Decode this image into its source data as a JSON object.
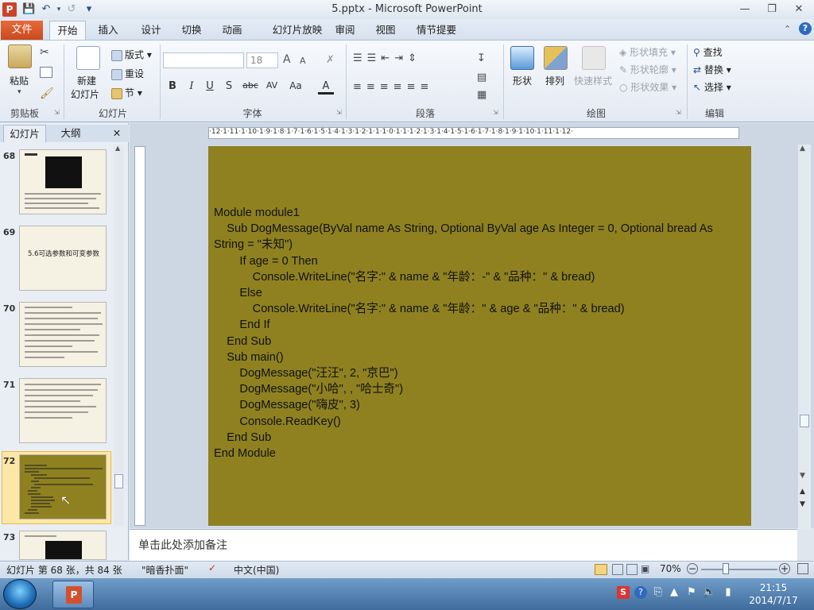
{
  "app": {
    "window_title": "5.pptx - Microsoft PowerPoint",
    "icon_letter": "P",
    "qat_customize": "▾"
  },
  "window_buttons": {
    "minimize": "—",
    "restore": "❐",
    "close": "✕"
  },
  "tabs": [
    "文件",
    "开始",
    "插入",
    "设计",
    "切换",
    "动画",
    "幻灯片放映",
    "审阅",
    "视图",
    "情节提要"
  ],
  "ribbon": {
    "clipboard": {
      "paste": "粘贴",
      "label": "剪贴板"
    },
    "slides": {
      "new_slide_line1": "新建",
      "new_slide_line2": "幻灯片",
      "layout": "版式",
      "reset": "重设",
      "section": "节",
      "label": "幻灯片"
    },
    "font": {
      "font_name": "",
      "font_size": "18",
      "grow": "A",
      "shrink": "A",
      "bold": "B",
      "italic": "I",
      "underline": "U",
      "shadow": "S",
      "strike": "abc",
      "spacing": "AV",
      "case": "Aa",
      "color": "A",
      "label": "字体"
    },
    "paragraph": {
      "label": "段落"
    },
    "drawing": {
      "shapes": "形状",
      "arrange": "排列",
      "quick_styles": "快速样式",
      "fill": "形状填充",
      "outline": "形状轮廓",
      "effects": "形状效果",
      "label": "绘图"
    },
    "editing": {
      "find": "查找",
      "replace": "替换",
      "select": "选择",
      "label": "编辑"
    }
  },
  "left_pane": {
    "tab_slides": "幻灯片",
    "tab_outline": "大纲",
    "close": "✕",
    "thumbnails": [
      {
        "num": "68",
        "title": ""
      },
      {
        "num": "69",
        "title": "5.6可选参数和可变参数"
      },
      {
        "num": "70",
        "title": ""
      },
      {
        "num": "71",
        "title": ""
      },
      {
        "num": "72",
        "title": ""
      },
      {
        "num": "73",
        "title": ""
      }
    ]
  },
  "ruler": {
    "h_ticks": "·12·1·11·1·10·1·9·1·8·1·7·1·6·1·5·1·4·1·3·1·2·1·1·1·0·1·1·1·2·1·3·1·4·1·5·1·6·1·7·1·8·1·9·1·10·1·11·1·12·"
  },
  "slide": {
    "background": "#8f8120",
    "code_lines": [
      "Module module1",
      "    Sub DogMessage(ByVal name As String, Optional ByVal age As Integer = 0, Optional bread As",
      "String = \"未知\")",
      "        If age = 0 Then",
      "            Console.WriteLine(\"名字:\" & name & \"年龄：-\" & \"品种：\" & bread)",
      "        Else",
      "            Console.WriteLine(\"名字:\" & name & \"年龄：\" & age & \"品种：\" & bread)",
      "        End If",
      "    End Sub",
      "    Sub main()",
      "        DogMessage(\"汪汪\", 2, \"京巴\")",
      "        DogMessage(\"小哈\", , \"哈士奇\")",
      "        DogMessage(\"嗨皮\", 3)",
      "        Console.ReadKey()",
      "    End Sub",
      "End Module"
    ]
  },
  "notes": {
    "placeholder": "单击此处添加备注"
  },
  "statusbar": {
    "slide_info": "幻灯片 第 68 张，共 84 张",
    "theme": "\"暗香扑面\"",
    "language": "中文(中国)",
    "zoom": "70%"
  },
  "taskbar": {
    "time": "21:15",
    "date": "2014/7/17"
  }
}
